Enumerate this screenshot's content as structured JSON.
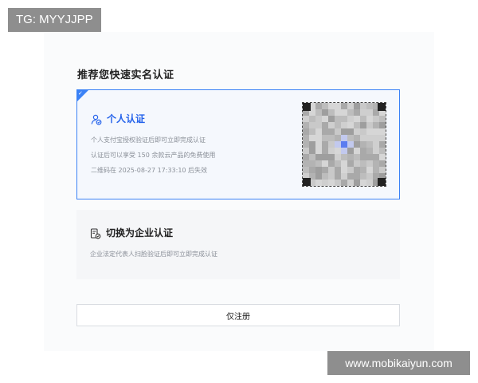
{
  "watermarks": {
    "top_left": "TG: MYYJJPP",
    "bottom_right": "www.mobikaiyun.com"
  },
  "heading": "推荐您快速实名认证",
  "personal": {
    "title": "个人认证",
    "icon": "person-verify-icon",
    "lines": [
      "个人支付宝授权验证后即可立即完成认证",
      "认证后可以享受 150 余款云产品的免费使用",
      "二维码在 2025-08-27 17:33:10 后失效"
    ],
    "selected": true,
    "accent": "#3b82f6"
  },
  "enterprise": {
    "title": "切换为企业认证",
    "icon": "enterprise-doc-icon",
    "description": "企业法定代表人扫脸验证后即可立即完成认证"
  },
  "register_button": "仅注册"
}
